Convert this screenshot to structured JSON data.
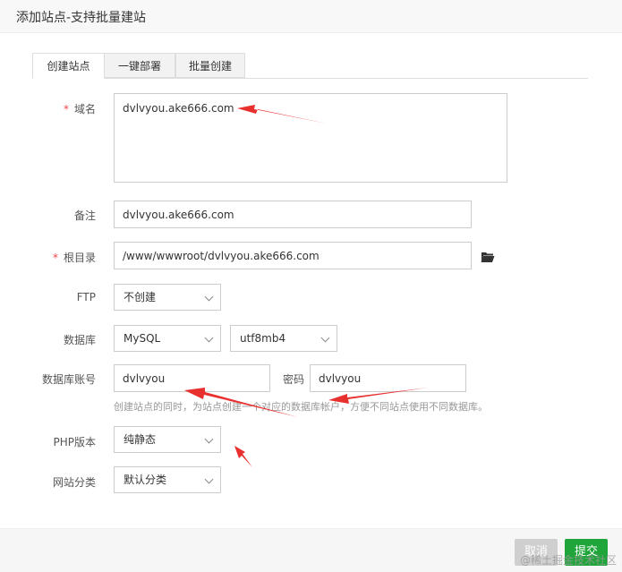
{
  "dialog": {
    "title": "添加站点-支持批量建站"
  },
  "tabs": [
    {
      "label": "创建站点"
    },
    {
      "label": "一键部署"
    },
    {
      "label": "批量创建"
    }
  ],
  "form": {
    "required_mark": "*",
    "domain": {
      "label": "域名",
      "value": "dvlvyou.ake666.com"
    },
    "remark": {
      "label": "备注",
      "value": "dvlvyou.ake666.com"
    },
    "root": {
      "label": "根目录",
      "value": "/www/wwwroot/dvlvyou.ake666.com"
    },
    "ftp": {
      "label": "FTP",
      "value": "不创建"
    },
    "database": {
      "label": "数据库",
      "type": "MySQL",
      "charset": "utf8mb4"
    },
    "db_account": {
      "label": "数据库账号",
      "value": "dvlvyou",
      "password_label": "密码",
      "password_value": "dvlvyou",
      "hint": "创建站点的同时，为站点创建一个对应的数据库帐户，方便不同站点使用不同数据库。"
    },
    "php": {
      "label": "PHP版本",
      "value": "纯静态"
    },
    "category": {
      "label": "网站分类",
      "value": "默认分类"
    }
  },
  "footer": {
    "cancel_label": "取消",
    "submit_label": "提交"
  },
  "watermark": "@稀土掘金技术社区",
  "colors": {
    "accent_green": "#20a53a",
    "required_red": "#f04848",
    "annotation_red": "#e8312f"
  }
}
